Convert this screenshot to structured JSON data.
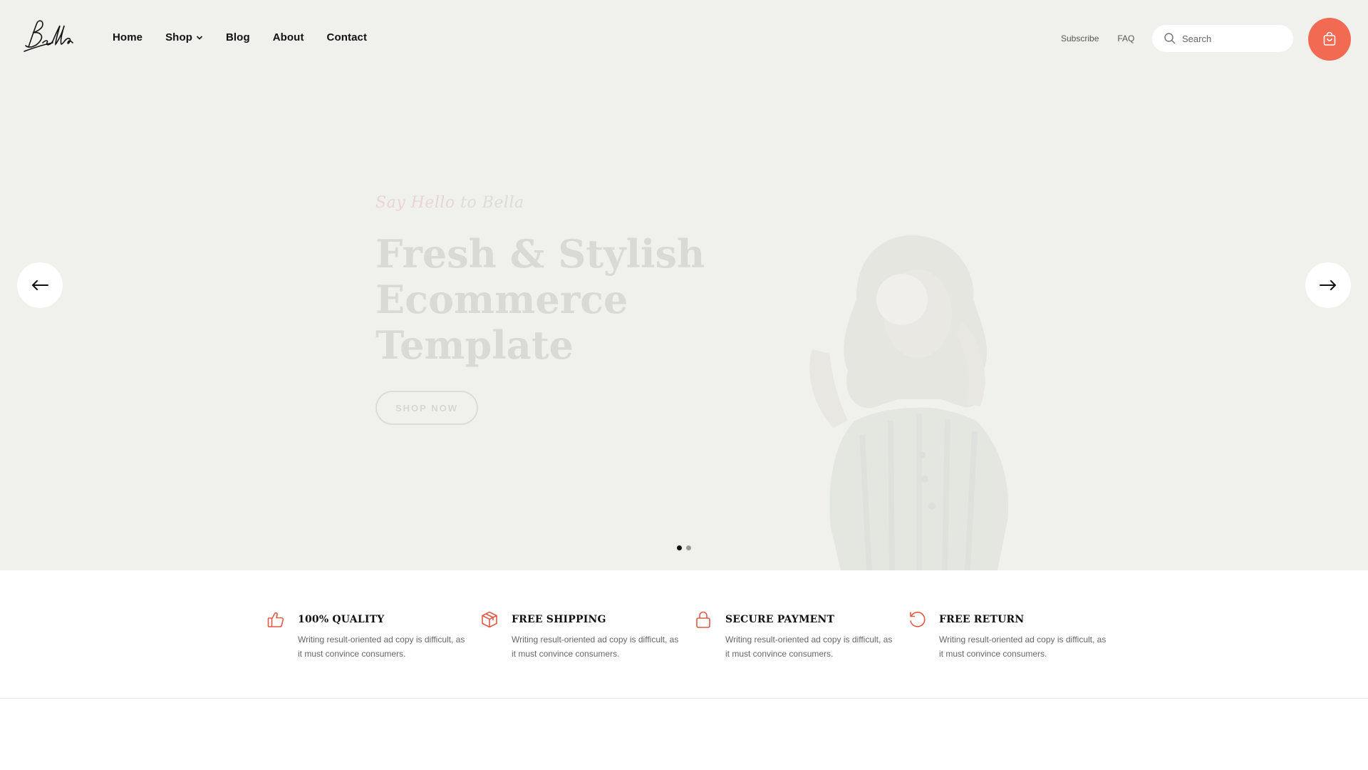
{
  "header": {
    "logo_text": "Bella",
    "nav": [
      {
        "label": "Home"
      },
      {
        "label": "Shop",
        "has_dropdown": true
      },
      {
        "label": "Blog"
      },
      {
        "label": "About"
      },
      {
        "label": "Contact"
      }
    ],
    "top_links": [
      "Subscribe",
      "FAQ"
    ],
    "search": {
      "placeholder": "Search",
      "icon": "search-icon"
    },
    "cart": {
      "icon": "shopping-bag-icon",
      "color": "#f26a52"
    }
  },
  "hero": {
    "background": "#f0f0ec",
    "tagline_accent": "Say Hello",
    "tagline_rest": "to Bella",
    "title_lines": [
      "Fresh & Stylish",
      "Ecommerce",
      "Template"
    ],
    "button_label": "SHOP NOW",
    "prev_icon": "arrow-left-icon",
    "next_icon": "arrow-right-icon",
    "slides": {
      "count": 2,
      "active": 1
    }
  },
  "features": [
    {
      "icon": "thumbs-up-icon",
      "title": "100% QUALITY",
      "desc": "Writing result-oriented ad copy is difficult, as it must convince consumers."
    },
    {
      "icon": "box-icon",
      "title": "FREE SHIPPING",
      "desc": "Writing result-oriented ad copy is difficult, as it must convince consumers."
    },
    {
      "icon": "lock-icon",
      "title": "SECURE PAYMENT",
      "desc": "Writing result-oriented ad copy is difficult, as it must convince consumers."
    },
    {
      "icon": "refresh-icon",
      "title": "FREE RETURN",
      "desc": "Writing result-oriented ad copy is difficult, as it must convince consumers."
    }
  ],
  "accent_color": "#e05a45"
}
